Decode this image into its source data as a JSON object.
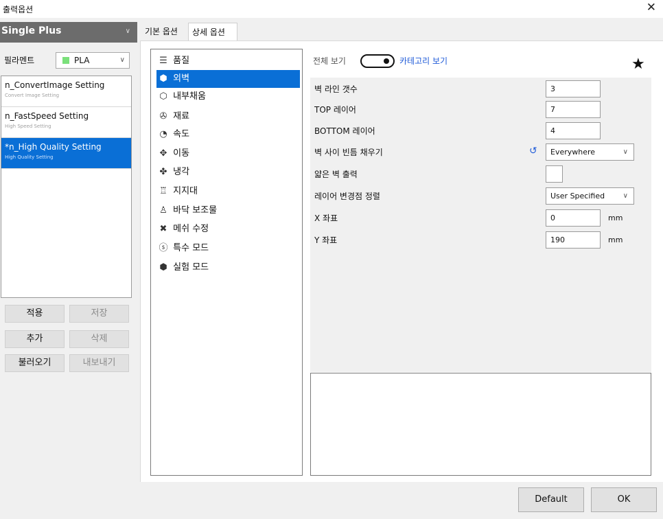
{
  "window": {
    "title": "출력옵션",
    "close_glyph": "✕"
  },
  "printer": {
    "name": "Single Plus"
  },
  "filament": {
    "label": "필라멘트",
    "value": "PLA",
    "color": "#7be07b"
  },
  "profiles": [
    {
      "name": "n_ConvertImage Setting",
      "sub": "Convert Image Setting"
    },
    {
      "name": "n_FastSpeed Setting",
      "sub": "High Speed Setting"
    },
    {
      "name": "*n_High Quality Setting",
      "sub": "High Quality Setting",
      "selected": true
    }
  ],
  "left_buttons": {
    "apply": "적용",
    "save": "저장",
    "add": "추가",
    "delete": "삭제",
    "load": "불러오기",
    "export": "내보내기"
  },
  "tabs": {
    "basic": "기본 옵션",
    "detail": "상세 옵션"
  },
  "categories": [
    {
      "icon": "quality-icon",
      "glyph": "☰",
      "label": "품질"
    },
    {
      "icon": "wall-icon",
      "glyph": "⬢",
      "label": "외벽",
      "selected": true
    },
    {
      "icon": "infill-icon",
      "glyph": "⬡",
      "label": "내부채움"
    },
    {
      "icon": "material-icon",
      "glyph": "✇",
      "label": "재료"
    },
    {
      "icon": "speed-icon",
      "glyph": "◔",
      "label": "속도"
    },
    {
      "icon": "travel-icon",
      "glyph": "✥",
      "label": "이동"
    },
    {
      "icon": "cooling-icon",
      "glyph": "✤",
      "label": "냉각"
    },
    {
      "icon": "support-icon",
      "glyph": "♖",
      "label": "지지대"
    },
    {
      "icon": "adhesion-icon",
      "glyph": "♙",
      "label": "바닥 보조물"
    },
    {
      "icon": "mesh-fix-icon",
      "glyph": "✖",
      "label": "메쉬 수정"
    },
    {
      "icon": "special-mode-icon",
      "glyph": "ⓢ",
      "label": "특수 모드"
    },
    {
      "icon": "experimental-icon",
      "glyph": "⬢",
      "label": "실험 모드"
    }
  ],
  "view": {
    "all_label": "전체 보기",
    "category_label": "카테고리 보기",
    "accent": "#1f5bd8"
  },
  "settings": {
    "wall_line_count": {
      "label": "벽 라인 갯수",
      "value": "3"
    },
    "top_layers": {
      "label": "TOP 레이어",
      "value": "7"
    },
    "bottom_layers": {
      "label": "BOTTOM 레이어",
      "value": "4"
    },
    "fill_gaps": {
      "label": "벽 사이 빈틈 채우기",
      "value": "Everywhere"
    },
    "thin_walls": {
      "label": "얇은 벽 출력"
    },
    "z_seam": {
      "label": "레이어 변경점 정렬",
      "value": "User Specified"
    },
    "x_coord": {
      "label": "X 좌표",
      "value": "0",
      "unit": "mm"
    },
    "y_coord": {
      "label": "Y 좌표",
      "value": "190",
      "unit": "mm"
    }
  },
  "footer": {
    "default": "Default",
    "ok": "OK"
  }
}
